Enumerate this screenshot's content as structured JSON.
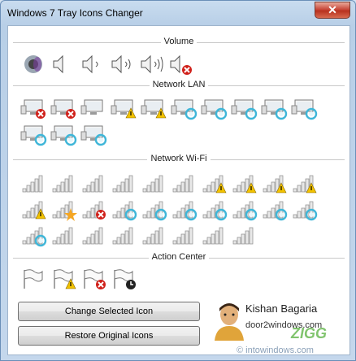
{
  "window": {
    "title": "Windows 7 Tray Icons Changer",
    "close_label": "✕"
  },
  "sections": {
    "volume": "Volume",
    "network_lan": "Network LAN",
    "network_wifi": "Network Wi-Fi",
    "action_center": "Action Center"
  },
  "volume_icons": [
    "speaker-sound-icon",
    "speaker-0-icon",
    "speaker-1-icon",
    "speaker-2-icon",
    "speaker-3-icon",
    "speaker-muted-icon"
  ],
  "lan_icons": [
    "lan-error",
    "lan-error",
    "lan-normal",
    "lan-warning",
    "lan-warning",
    "lan-busy",
    "lan-busy",
    "lan-busy",
    "lan-busy",
    "lan-busy",
    "lan-busy",
    "lan-busy",
    "lan-busy"
  ],
  "wifi_icons": [
    "wifi",
    "wifi",
    "wifi",
    "wifi",
    "wifi",
    "wifi",
    "wifi-warning",
    "wifi-warning",
    "wifi-warning",
    "wifi-warning",
    "wifi-warning",
    "wifi-star",
    "wifi-error",
    "wifi-busy",
    "wifi-busy",
    "wifi-busy",
    "wifi-busy",
    "wifi-busy",
    "wifi-busy",
    "wifi-busy",
    "wifi-busy",
    "wifi",
    "wifi",
    "wifi",
    "wifi",
    "wifi",
    "wifi",
    "wifi"
  ],
  "action_icons": [
    "flag-icon",
    "flag-warning-icon",
    "flag-error-icon",
    "flag-clock-icon"
  ],
  "buttons": {
    "change": "Change Selected Icon",
    "restore": "Restore Original Icons"
  },
  "author": {
    "name": "Kishan Bagaria",
    "site": "door2windows.com"
  },
  "watermarks": {
    "logo": "ZIGG",
    "footer": "© intowindows.com"
  },
  "colors": {
    "accent": "#2a8fd0",
    "error": "#d0201a",
    "warning": "#f2c200",
    "busy": "#3fb6d8"
  }
}
